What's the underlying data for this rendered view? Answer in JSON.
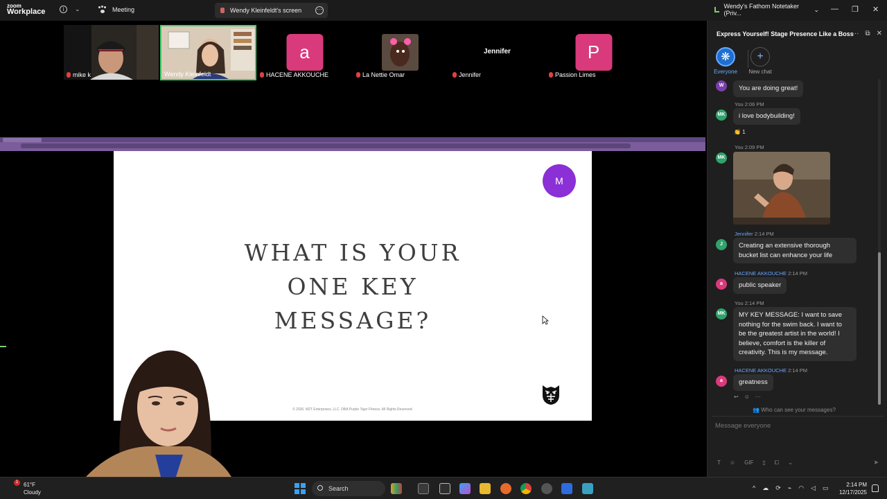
{
  "titlebar": {
    "logo_line1": "zoom",
    "logo_line2": "Workplace",
    "meeting_label": "Meeting",
    "screen_tab_label": "Wendy Kleinfeldt's screen",
    "fathom_label": "Wendy's Fathom Notetaker (Priv...",
    "win_minimize": "—",
    "win_restore": "❐",
    "win_close": "✕"
  },
  "participants": [
    {
      "name": "mike k",
      "type": "video",
      "active": false
    },
    {
      "name": "Wendy Kleinfeldt",
      "type": "video",
      "active": true
    },
    {
      "name": "HACENE AKKOUCHE",
      "type": "avatar",
      "initial": "a",
      "color": "#d93a7c"
    },
    {
      "name": "La Nettie Omar",
      "type": "video",
      "active": false
    },
    {
      "name": "Jennifer",
      "type": "text",
      "active": false
    },
    {
      "name": "Passion Limes",
      "type": "avatar",
      "initial": "P",
      "color": "#d93a7c"
    }
  ],
  "slide": {
    "avatar_initial": "M",
    "title_line1": "WHAT IS YOUR",
    "title_line2": "ONE KEY",
    "title_line3": "MESSAGE?",
    "footer": "© 2026. M2T Enterprises, LLC. DBA Purple Tiger Fitness. All Rights Reserved."
  },
  "chat": {
    "title": "Express Yourself! Stage Presence Like a Boss",
    "tabs": [
      {
        "label": "Everyone"
      },
      {
        "label": "New chat"
      }
    ],
    "messages": [
      {
        "avatar": "W",
        "avatar_color": "#7a3fa8",
        "sender": "",
        "time": "",
        "text": "You are doing great!"
      },
      {
        "avatar": "MK",
        "avatar_color": "#2fa36b",
        "sender": "You",
        "time": "2:06 PM",
        "text": "i love bodybuilding!"
      },
      {
        "avatar": "MK",
        "avatar_color": "#2fa36b",
        "sender": "You",
        "time": "2:09 PM",
        "text": ""
      },
      {
        "avatar": "J",
        "avatar_color": "#2fa36b",
        "sender": "Jennifer",
        "time": "2:14 PM",
        "text": "Creating an extensive thorough bucket list can enhance your life"
      },
      {
        "avatar": "a",
        "avatar_color": "#d93a7c",
        "sender": "HACENE AKKOUCHE",
        "time": "2:14 PM",
        "text": "public speaker"
      },
      {
        "avatar": "MK",
        "avatar_color": "#2fa36b",
        "sender": "You",
        "time": "2:14 PM",
        "text": "MY KEY MESSAGE: I want to save nothing for the swim back. I want to be the greatest artist in the world! I believe, comfort is the killer of creativity. This is my message."
      },
      {
        "avatar": "a",
        "avatar_color": "#d93a7c",
        "sender": "HACENE AKKOUCHE",
        "time": "2:14 PM",
        "text": "greatness"
      }
    ],
    "reaction_count": "1",
    "privacy": "Who can see your messages?",
    "compose_placeholder": "Message everyone",
    "gif_label": "GIF"
  },
  "taskbar": {
    "weather_temp": "61°F",
    "weather_desc": "Cloudy",
    "weather_badge": "1",
    "search_label": "Search",
    "time": "2:14 PM",
    "date": "12/17/2025"
  }
}
